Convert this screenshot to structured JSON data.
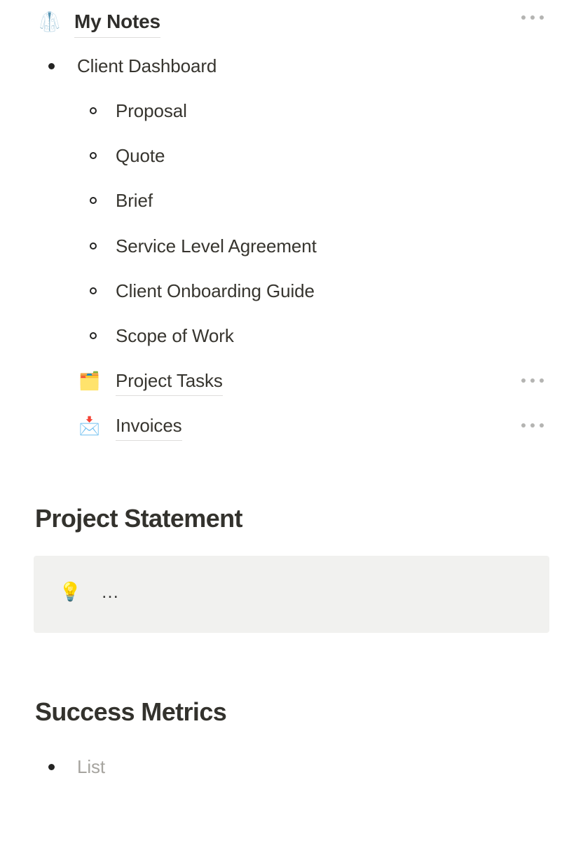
{
  "page": {
    "background_color": "#ffffff",
    "text_color": "#37352f",
    "placeholder_color": "#a6a49f"
  },
  "header": {
    "emoji": "🥼",
    "emoji_name": "lab-coat-emoji",
    "title": "My Notes",
    "menu_label": "•••"
  },
  "outline": {
    "top_item": {
      "label": "Client Dashboard",
      "bullet": "•"
    },
    "sub_items": [
      {
        "label": "Proposal"
      },
      {
        "label": "Quote"
      },
      {
        "label": "Brief"
      },
      {
        "label": "Service Level Agreement"
      },
      {
        "label": "Client Onboarding Guide"
      },
      {
        "label": "Scope of Work"
      }
    ],
    "page_links": [
      {
        "label": "Project Tasks",
        "emoji": "🗂️",
        "emoji_name": "checklist-emoji",
        "menu_label": "•••"
      },
      {
        "label": "Invoices",
        "emoji": "📩",
        "emoji_name": "money-envelope-emoji",
        "menu_label": "•••"
      }
    ]
  },
  "sections": [
    {
      "heading": "Project Statement",
      "callout": {
        "emoji": "💡",
        "emoji_name": "lightbulb-emoji",
        "placeholder": "…",
        "background_color": "#f1f1ef"
      }
    },
    {
      "heading": "Success Metrics",
      "list_placeholder": "List"
    }
  ]
}
